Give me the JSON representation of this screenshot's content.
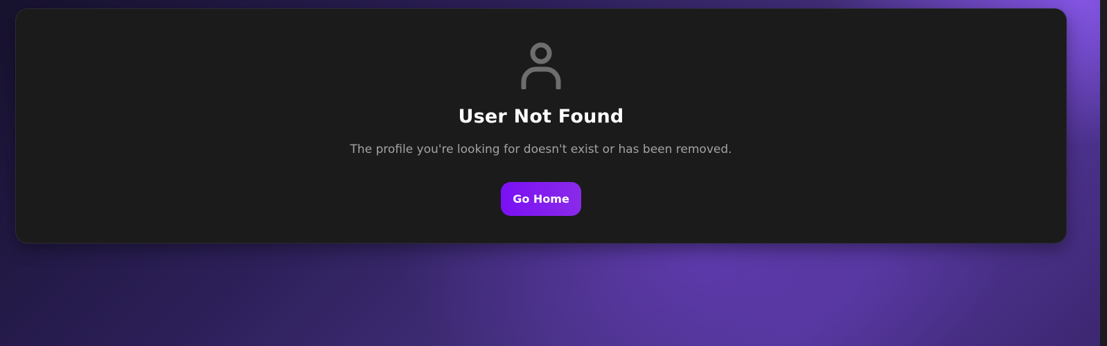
{
  "error": {
    "icon": "user-icon",
    "title": "User Not Found",
    "message": "The profile you're looking for doesn't exist or has been removed.",
    "button_label": "Go Home"
  },
  "colors": {
    "accent": "#7a10f5",
    "card_background": "#1b1b1b",
    "icon": "#6e6e6e",
    "title": "#ffffff",
    "message": "#a3a3a3"
  }
}
